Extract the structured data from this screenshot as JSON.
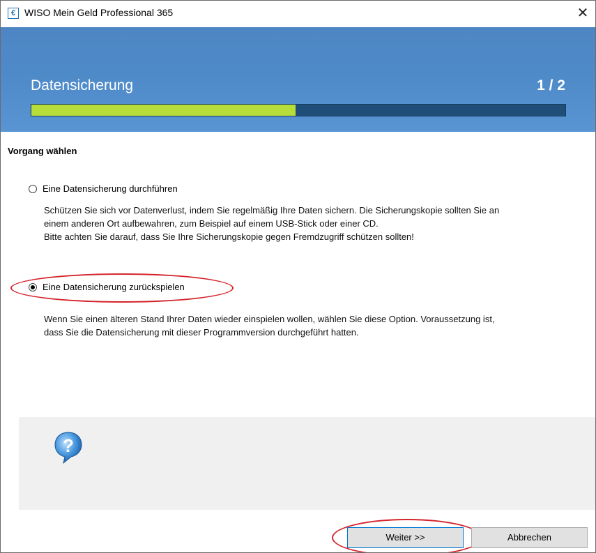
{
  "window": {
    "title": "WISO Mein Geld Professional 365",
    "app_icon_glyph": "€",
    "close_glyph": "✕"
  },
  "header": {
    "title": "Datensicherung",
    "step": "1 / 2",
    "progress_fraction": 0.495
  },
  "section": {
    "title": "Vorgang wählen"
  },
  "options": [
    {
      "label": "Eine Datensicherung durchführen",
      "checked": false,
      "description": [
        "Schützen Sie sich vor Datenverlust, indem Sie regelmäßig Ihre Daten sichern. Die Sicherungskopie sollten Sie an",
        "einem anderen Ort aufbewahren, zum Beispiel auf einem USB-Stick oder einer CD.",
        "Bitte achten Sie darauf, dass Sie Ihre Sicherungskopie gegen Fremdzugriff schützen sollten!"
      ]
    },
    {
      "label": "Eine Datensicherung zurückspielen",
      "checked": true,
      "description": [
        "Wenn Sie einen älteren Stand Ihrer Daten wieder einspielen wollen, wählen Sie diese Option. Voraussetzung ist,",
        "dass Sie die Datensicherung mit dieser Programmversion durchgeführt hatten."
      ]
    }
  ],
  "help": {
    "icon": "question-mark-bubble-icon"
  },
  "buttons": {
    "next": "Weiter >>",
    "cancel": "Abbrechen"
  },
  "colors": {
    "header_blue": "#4f8ac9",
    "progress_track": "#1f4e78",
    "progress_fill": "#b6dd3a",
    "annotation_red": "#d4242a"
  }
}
